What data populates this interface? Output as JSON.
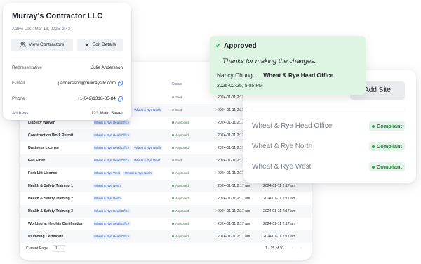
{
  "table": {
    "headers": {
      "status": "Status"
    },
    "rows": [
      {
        "doc": "",
        "tags": [
          "Wheat & Rye Head Office"
        ],
        "status": "Sent",
        "status_type": "sent",
        "d1": "2024-01-11 2:17 am",
        "d2": ""
      },
      {
        "doc": "",
        "tags": [
          "Wheat & Rye Head Office",
          "Wheat & Rye North"
        ],
        "status": "Sent",
        "status_type": "sent",
        "d1": "2024-01-11 2:17 am",
        "d2": ""
      },
      {
        "doc": "Liability Waiver",
        "tags": [
          "Wheat & Rye Head Office"
        ],
        "status": "Approved",
        "status_type": "approved",
        "d1": "2024-01-11 2:17 am",
        "d2": ""
      },
      {
        "doc": "Construction Work Permit",
        "tags": [
          "Wheat & Rye Head Office"
        ],
        "status": "Approved",
        "status_type": "approved",
        "d1": "2024-01-11 2:17 am",
        "d2": ""
      },
      {
        "doc": "Business License",
        "tags": [
          "Wheat & Rye Head Office",
          "Wheat & Rye North"
        ],
        "status": "Approved",
        "status_type": "approved",
        "d1": "2024-01-11 2:17 am",
        "d2": ""
      },
      {
        "doc": "Gas Fitter",
        "tags": [
          "Wheat & Rye Head Office",
          "Wheat & Rye West"
        ],
        "status": "Sent",
        "status_type": "sent",
        "d1": "2024-01-11 2:17 am",
        "d2": ""
      },
      {
        "doc": "Fork Lift License",
        "tags": [
          "Wheat & Rye West",
          "Wheat & Rye North"
        ],
        "status": "Approved",
        "status_type": "approved",
        "d1": "2024-01-11 2:17 am",
        "d2": "2024-01-11 2:17 am"
      },
      {
        "doc": "Health & Safety Training 1",
        "tags": [
          "Wheat & Rye North"
        ],
        "status": "Approved",
        "status_type": "approved",
        "d1": "2024-01-11 2:17 am",
        "d2": "2024-01-11 2:17 am"
      },
      {
        "doc": "Health & Safety Training 2",
        "tags": [
          "Wheat & Rye North"
        ],
        "status": "Approved",
        "status_type": "approved",
        "d1": "2024-01-11 2:17 am",
        "d2": "2024-01-11 2:17 am"
      },
      {
        "doc": "Health & Safety Training 3",
        "tags": [
          "Wheat & Rye Head Office"
        ],
        "status": "Approved",
        "status_type": "approved",
        "d1": "2024-01-11 2:17 am",
        "d2": "2024-01-11 2:17 am"
      },
      {
        "doc": "Working at Heights Certification",
        "tags": [
          "Wheat & Rye Head Office"
        ],
        "status": "Approved",
        "status_type": "approved",
        "d1": "2024-01-11 2:17 am",
        "d2": "2024-01-11 2:17 am"
      },
      {
        "doc": "Plumbing Certificate",
        "tags": [
          "Wheat & Rye Head Office"
        ],
        "status": "Approved",
        "status_type": "approved",
        "d1": "2024-01-11 2:17 am",
        "d2": "2024-01-11 2:17 am"
      }
    ],
    "footer": {
      "current_page_label": "Current Page",
      "page": "1",
      "page_caret": "⌄",
      "range": "1 - 15 of 30",
      "prev_icon": "‹",
      "next_icon": "›"
    }
  },
  "contractor": {
    "name": "Murray's Contractor LLC",
    "active_last": "Active Last: Mar 13, 2025, 2:42",
    "view_button": "View Contractors",
    "edit_button": "Edit Details",
    "fields": [
      {
        "label": "Representative",
        "value": "Julie Andersson",
        "copy": false
      },
      {
        "label": "E-mail",
        "value": "j.andersson@murraysllc.com",
        "copy": true
      },
      {
        "label": "Phone",
        "value": "+1(042)1318-85-84",
        "copy": true
      },
      {
        "label": "Address",
        "value": "123 Main Street",
        "copy": false
      }
    ]
  },
  "approval": {
    "title": "Approved",
    "check_icon": "✔",
    "message": "Thanks for making the changes.",
    "approver": "Nancy Chung",
    "separator": "·",
    "site": "Wheat & Rye Head Office",
    "timestamp": "2025-02-25, 5:05 PM"
  },
  "sites": {
    "add_button": "Add Site",
    "items": [
      {
        "name": "Wheat & Rye Head Office",
        "status": "Compliant"
      },
      {
        "name": "Wheat & Rye North",
        "status": "Compliant"
      },
      {
        "name": "Wheat & Rye West",
        "status": "Compliant"
      }
    ]
  },
  "colors": {
    "approved_bg": "#dff5e4",
    "compliant_green": "#2a7a44",
    "tag_blue": "#2b5bd7"
  }
}
